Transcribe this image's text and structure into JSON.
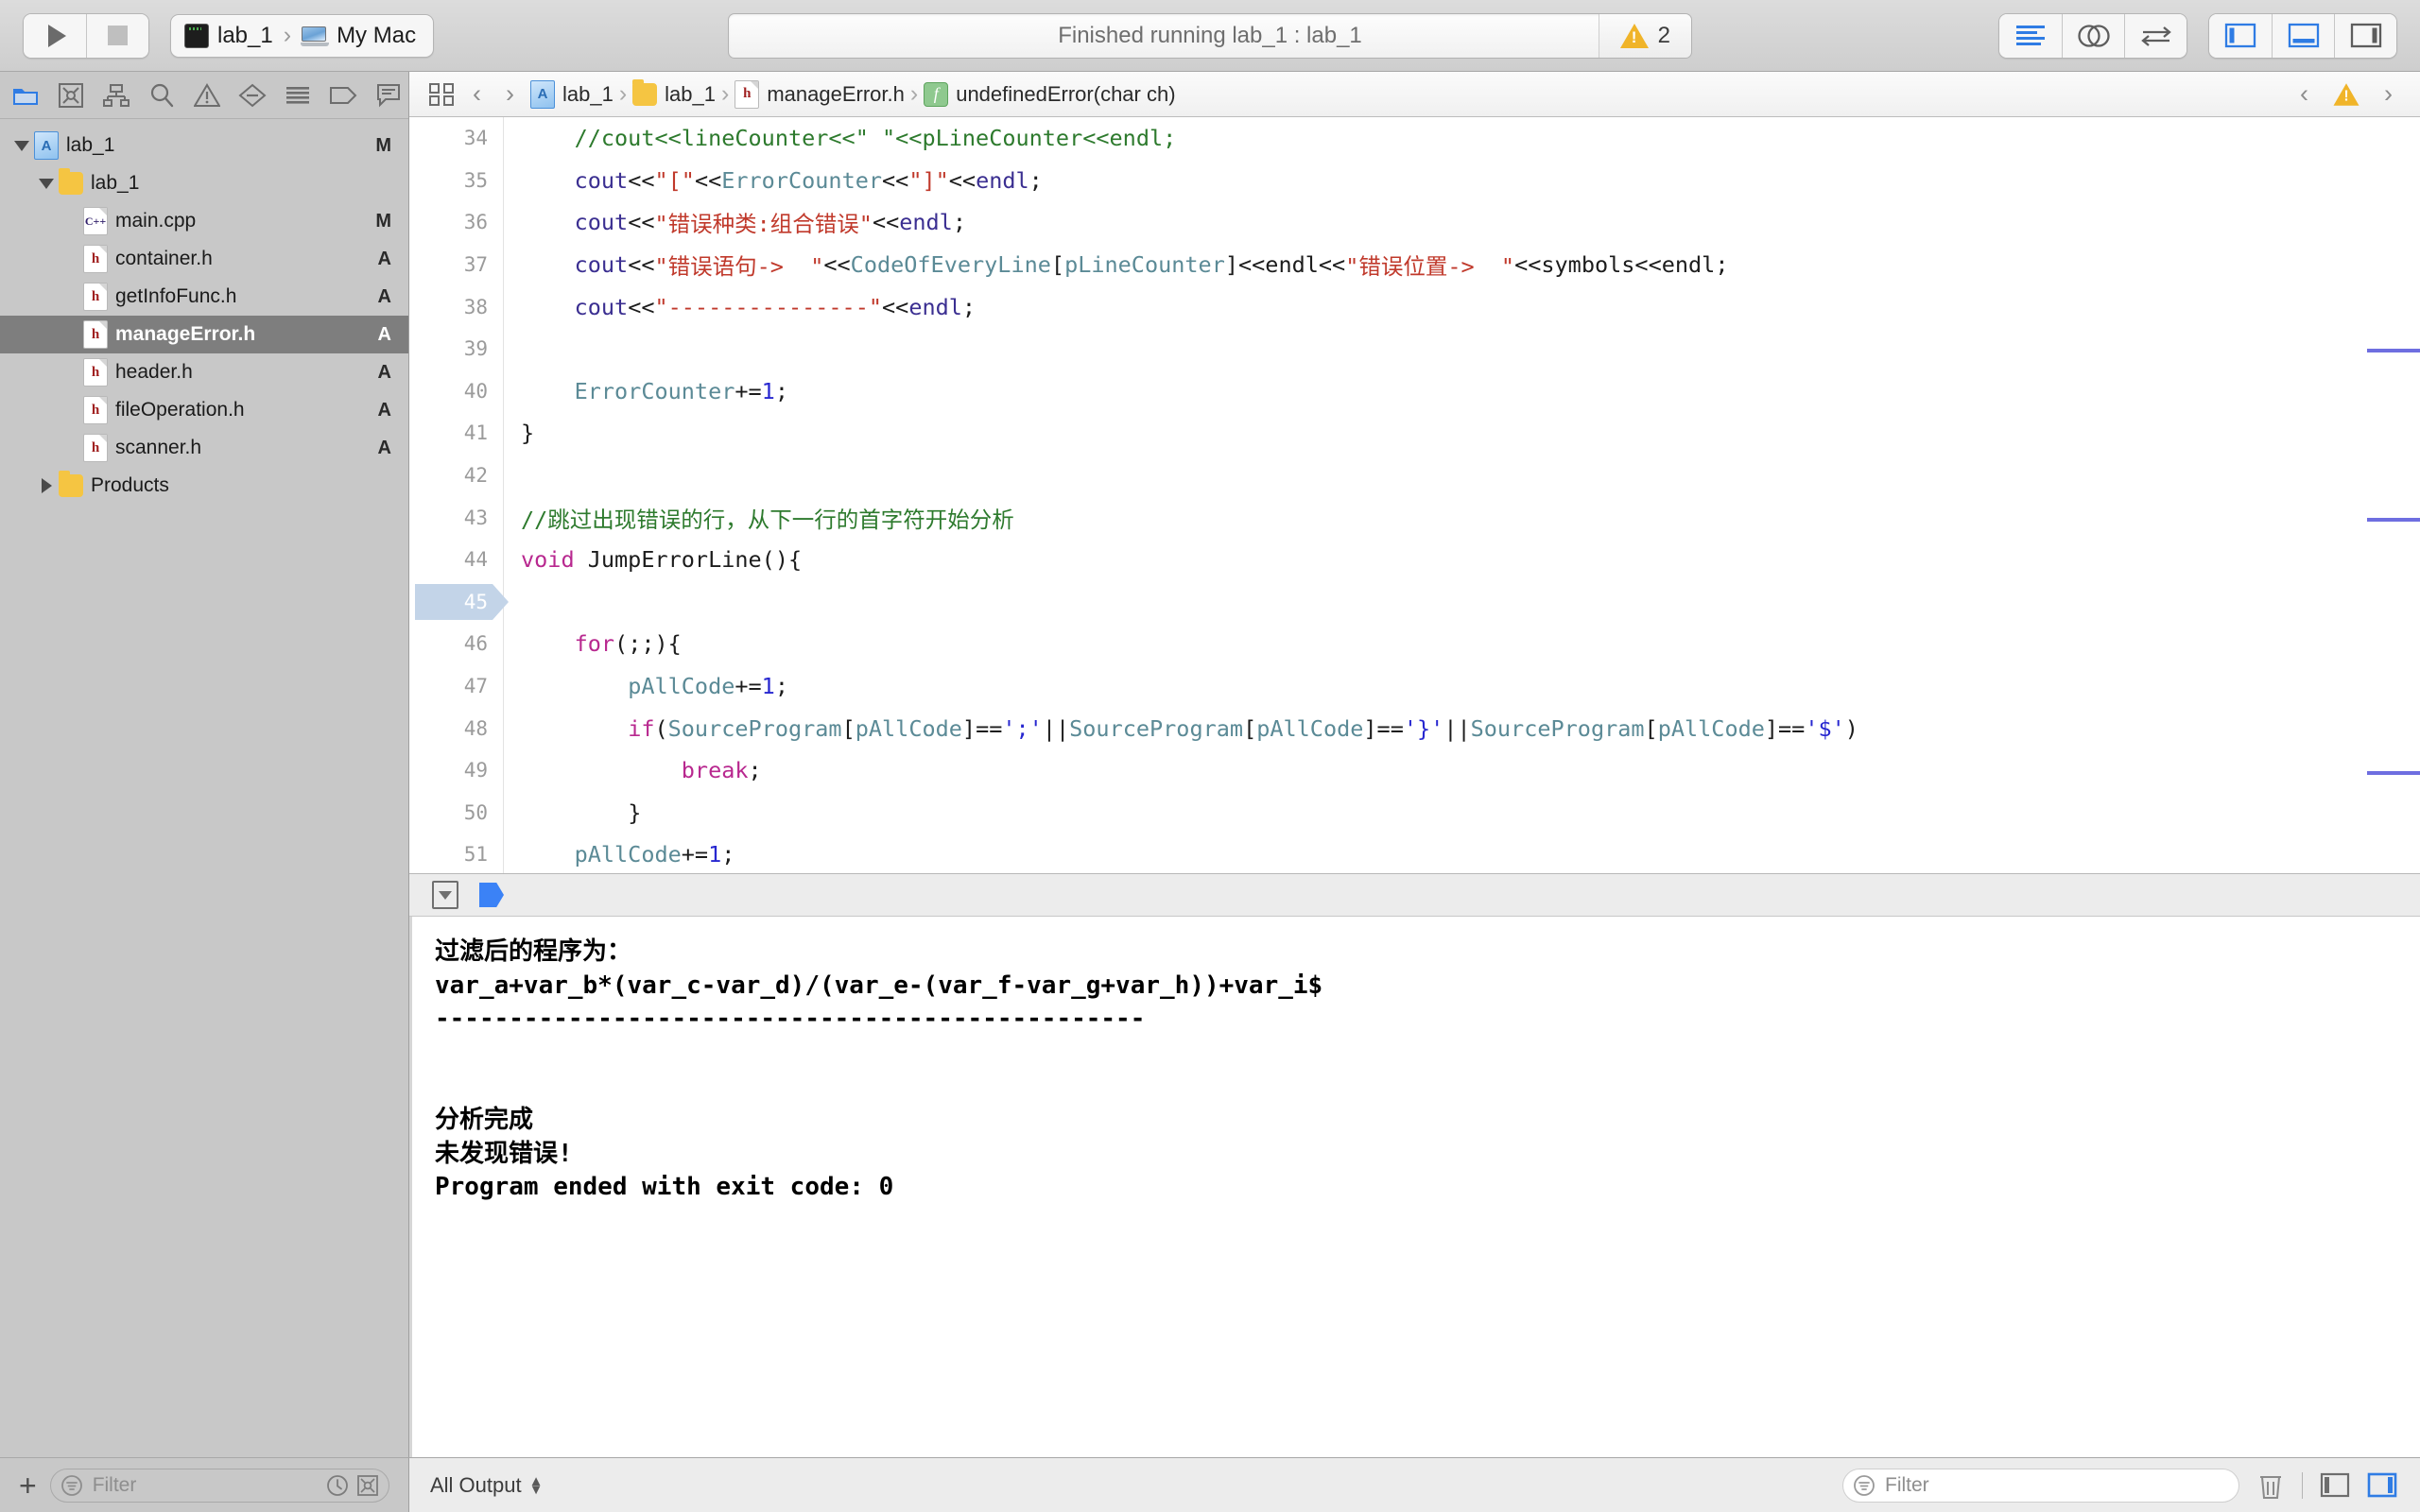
{
  "toolbar": {
    "run_label": "run-button",
    "stop_label": "stop-button",
    "scheme_name": "lab_1",
    "destination": "My Mac",
    "status_text": "Finished running lab_1 : lab_1",
    "warning_count": "2",
    "editor_modes": [
      "standard-editor",
      "assistant-editor",
      "version-editor"
    ],
    "view_toggles": [
      "navigator-toggle",
      "debug-area-toggle",
      "utilities-toggle"
    ]
  },
  "navigator": {
    "tabs": [
      "project-navigator",
      "source-control-navigator",
      "symbol-navigator",
      "find-navigator",
      "issue-navigator",
      "test-navigator",
      "debug-navigator",
      "breakpoint-navigator",
      "report-navigator"
    ],
    "selected_tab": "project-navigator",
    "tree": [
      {
        "label": "lab_1",
        "icon": "project",
        "depth": 0,
        "twisty": "down",
        "status": "M",
        "selected": false
      },
      {
        "label": "lab_1",
        "icon": "folder",
        "depth": 1,
        "twisty": "down",
        "status": "",
        "selected": false
      },
      {
        "label": "main.cpp",
        "icon": "cpp",
        "depth": 2,
        "twisty": "none",
        "status": "M",
        "selected": false
      },
      {
        "label": "container.h",
        "icon": "h",
        "depth": 2,
        "twisty": "none",
        "status": "A",
        "selected": false
      },
      {
        "label": "getInfoFunc.h",
        "icon": "h",
        "depth": 2,
        "twisty": "none",
        "status": "A",
        "selected": false
      },
      {
        "label": "manageError.h",
        "icon": "h",
        "depth": 2,
        "twisty": "none",
        "status": "A",
        "selected": true
      },
      {
        "label": "header.h",
        "icon": "h",
        "depth": 2,
        "twisty": "none",
        "status": "A",
        "selected": false
      },
      {
        "label": "fileOperation.h",
        "icon": "h",
        "depth": 2,
        "twisty": "none",
        "status": "A",
        "selected": false
      },
      {
        "label": "scanner.h",
        "icon": "h",
        "depth": 2,
        "twisty": "none",
        "status": "A",
        "selected": false
      },
      {
        "label": "Products",
        "icon": "folder",
        "depth": 1,
        "twisty": "right",
        "status": "",
        "selected": false
      }
    ]
  },
  "jumpbar": {
    "back_arrow": "‹",
    "forward_arrow": "›",
    "crumbs": [
      {
        "label": "lab_1",
        "icon": "project"
      },
      {
        "label": "lab_1",
        "icon": "folder"
      },
      {
        "label": "manageError.h",
        "icon": "h"
      },
      {
        "label": "undefinedError(char ch)",
        "icon": "func"
      }
    ],
    "separator": "›",
    "right_prev": "‹",
    "right_next": "›"
  },
  "editor": {
    "first_line": 34,
    "current_line": 45,
    "lines": [
      {
        "n": 34,
        "tokens": [
          {
            "t": "    ",
            "c": "plain"
          },
          {
            "t": "//cout<<lineCounter<<\" \"<<pLineCounter<<endl;",
            "c": "comment"
          }
        ]
      },
      {
        "n": 35,
        "tokens": [
          {
            "t": "    ",
            "c": "plain"
          },
          {
            "t": "cout",
            "c": "global"
          },
          {
            "t": "<<",
            "c": "plain"
          },
          {
            "t": "\"[\"",
            "c": "str"
          },
          {
            "t": "<<",
            "c": "plain"
          },
          {
            "t": "ErrorCounter",
            "c": "member"
          },
          {
            "t": "<<",
            "c": "plain"
          },
          {
            "t": "\"]\"",
            "c": "str"
          },
          {
            "t": "<<",
            "c": "plain"
          },
          {
            "t": "endl",
            "c": "global"
          },
          {
            "t": ";",
            "c": "plain"
          }
        ]
      },
      {
        "n": 36,
        "tokens": [
          {
            "t": "    ",
            "c": "plain"
          },
          {
            "t": "cout",
            "c": "global"
          },
          {
            "t": "<<",
            "c": "plain"
          },
          {
            "t": "\"错误种类:组合错误\"",
            "c": "str"
          },
          {
            "t": "<<",
            "c": "plain"
          },
          {
            "t": "endl",
            "c": "global"
          },
          {
            "t": ";",
            "c": "plain"
          }
        ]
      },
      {
        "n": 37,
        "tokens": [
          {
            "t": "    ",
            "c": "plain"
          },
          {
            "t": "cout",
            "c": "global"
          },
          {
            "t": "<<",
            "c": "plain"
          },
          {
            "t": "\"错误语句->  \"",
            "c": "str"
          },
          {
            "t": "<<",
            "c": "plain"
          },
          {
            "t": "CodeOfEveryLine",
            "c": "member"
          },
          {
            "t": "[",
            "c": "plain"
          },
          {
            "t": "pLineCounter",
            "c": "member"
          },
          {
            "t": "]<<",
            "c": "plain"
          },
          {
            "t": "endl",
            "c": "plain"
          },
          {
            "t": "<<",
            "c": "plain"
          },
          {
            "t": "\"错误位置->  \"",
            "c": "str"
          },
          {
            "t": "<<",
            "c": "plain"
          },
          {
            "t": "symbols",
            "c": "plain"
          },
          {
            "t": "<<",
            "c": "plain"
          },
          {
            "t": "endl",
            "c": "plain"
          },
          {
            "t": ";",
            "c": "plain"
          }
        ]
      },
      {
        "n": 38,
        "tokens": [
          {
            "t": "    ",
            "c": "plain"
          },
          {
            "t": "cout",
            "c": "global"
          },
          {
            "t": "<<",
            "c": "plain"
          },
          {
            "t": "\"---------------\"",
            "c": "str"
          },
          {
            "t": "<<",
            "c": "plain"
          },
          {
            "t": "endl",
            "c": "global"
          },
          {
            "t": ";",
            "c": "plain"
          }
        ]
      },
      {
        "n": 39,
        "tokens": []
      },
      {
        "n": 40,
        "tokens": [
          {
            "t": "    ",
            "c": "plain"
          },
          {
            "t": "ErrorCounter",
            "c": "member"
          },
          {
            "t": "+=",
            "c": "plain"
          },
          {
            "t": "1",
            "c": "num"
          },
          {
            "t": ";",
            "c": "plain"
          }
        ]
      },
      {
        "n": 41,
        "tokens": [
          {
            "t": "}",
            "c": "plain"
          }
        ]
      },
      {
        "n": 42,
        "tokens": []
      },
      {
        "n": 43,
        "tokens": [
          {
            "t": "//跳过出现错误的行，从下一行的首字符开始分析",
            "c": "comment"
          }
        ]
      },
      {
        "n": 44,
        "tokens": [
          {
            "t": "void",
            "c": "kw"
          },
          {
            "t": " JumpErrorLine(){",
            "c": "plain"
          }
        ]
      },
      {
        "n": 45,
        "tokens": []
      },
      {
        "n": 46,
        "tokens": [
          {
            "t": "    ",
            "c": "plain"
          },
          {
            "t": "for",
            "c": "kw"
          },
          {
            "t": "(;;){",
            "c": "plain"
          }
        ]
      },
      {
        "n": 47,
        "tokens": [
          {
            "t": "        ",
            "c": "plain"
          },
          {
            "t": "pAllCode",
            "c": "member"
          },
          {
            "t": "+=",
            "c": "plain"
          },
          {
            "t": "1",
            "c": "num"
          },
          {
            "t": ";",
            "c": "plain"
          }
        ]
      },
      {
        "n": 48,
        "tokens": [
          {
            "t": "        ",
            "c": "plain"
          },
          {
            "t": "if",
            "c": "kw"
          },
          {
            "t": "(",
            "c": "plain"
          },
          {
            "t": "SourceProgram",
            "c": "member"
          },
          {
            "t": "[",
            "c": "plain"
          },
          {
            "t": "pAllCode",
            "c": "member"
          },
          {
            "t": "]==",
            "c": "plain"
          },
          {
            "t": "';'",
            "c": "char"
          },
          {
            "t": "||",
            "c": "plain"
          },
          {
            "t": "SourceProgram",
            "c": "member"
          },
          {
            "t": "[",
            "c": "plain"
          },
          {
            "t": "pAllCode",
            "c": "member"
          },
          {
            "t": "]==",
            "c": "plain"
          },
          {
            "t": "'}'",
            "c": "char"
          },
          {
            "t": "||",
            "c": "plain"
          },
          {
            "t": "SourceProgram",
            "c": "member"
          },
          {
            "t": "[",
            "c": "plain"
          },
          {
            "t": "pAllCode",
            "c": "member"
          },
          {
            "t": "]==",
            "c": "plain"
          },
          {
            "t": "'$'",
            "c": "char"
          },
          {
            "t": ")",
            "c": "plain"
          }
        ]
      },
      {
        "n": 49,
        "tokens": [
          {
            "t": "            ",
            "c": "plain"
          },
          {
            "t": "break",
            "c": "kw"
          },
          {
            "t": ";",
            "c": "plain"
          }
        ]
      },
      {
        "n": 50,
        "tokens": [
          {
            "t": "        ",
            "c": "plain"
          },
          {
            "t": "}",
            "c": "plain"
          }
        ]
      },
      {
        "n": 51,
        "tokens": [
          {
            "t": "    ",
            "c": "plain"
          },
          {
            "t": "pAllCode",
            "c": "member"
          },
          {
            "t": "+=",
            "c": "plain"
          },
          {
            "t": "1",
            "c": "num"
          },
          {
            "t": ";",
            "c": "plain"
          }
        ]
      }
    ]
  },
  "console": {
    "output_lines": [
      "过滤后的程序为：",
      "var_a+var_b*(var_c-var_d)/(var_e-(var_f-var_g+var_h))+var_i$",
      "------------------------------------------------",
      "",
      "",
      "分析完成",
      "未发现错误!",
      "Program ended with exit code: 0"
    ]
  },
  "bottombar": {
    "add_label": "+",
    "left_filter_placeholder": "Filter",
    "output_scope": "All Output",
    "right_filter_placeholder": "Filter",
    "trash_label": "clear-console"
  },
  "colors": {
    "accent_blue": "#2f7ce4",
    "warning_yellow": "#f0b429",
    "selection_gray": "#7e7e7e",
    "current_line_blue": "#c3d4e8",
    "comment_green": "#2d7a2d",
    "string_red": "#c0392b",
    "keyword_magenta": "#b8288f",
    "number_blue": "#2727d0",
    "global_purple": "#3b2f91",
    "member_teal": "#5b8a96"
  }
}
